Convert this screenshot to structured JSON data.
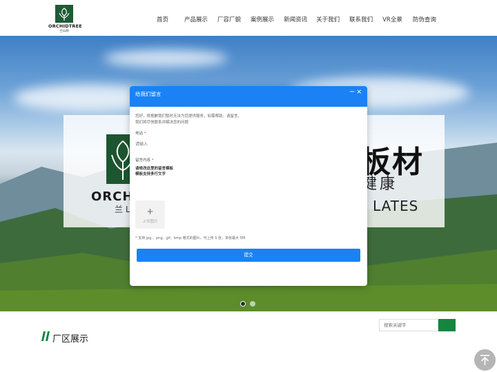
{
  "brand": {
    "logo_text": "ORCHIDTREE",
    "logo_sub": "兰山树"
  },
  "nav": {
    "items": [
      "首页",
      "产品展示",
      "厂容厂貌",
      "案例展示",
      "新闻资讯",
      "关于我们",
      "联系我们",
      "VR全景",
      "防伪查询"
    ]
  },
  "banner": {
    "brand": "ORCHI",
    "brand_sub": "兰 L",
    "cn_big": "板材",
    "cn_small": "健康",
    "en": "LATES",
    "slides": 2,
    "active_slide": 1
  },
  "modal": {
    "title": "给我们留言",
    "minimize": "−",
    "close": "×",
    "intro_line1": "您好，很抱歉我们暂时无法为您提供服务，如需帮助，请留言，",
    "intro_line2": "我们将尽快联系并解决您的问题",
    "phone_label": "电话",
    "phone_placeholder": "请输入",
    "content_label": "留言内容",
    "content_line1": "请修改这里的留言模板",
    "content_line2": "模板支持多行文字",
    "upload_plus": "+",
    "upload_label": "上传图片",
    "upload_hint": "* 支持 jpg 、png、gif、bmp 格式的图片，可上传 5 张，单张最大 5M",
    "submit_label": "提交",
    "required_mark": "*"
  },
  "search": {
    "placeholder": "搜索关键字"
  },
  "section": {
    "title": "厂区展示"
  },
  "colors": {
    "accent_blue": "#1a82f5",
    "brand_green": "#15863f"
  },
  "icons": {
    "back_top": "arrow-up-icon",
    "search": "search-icon"
  }
}
